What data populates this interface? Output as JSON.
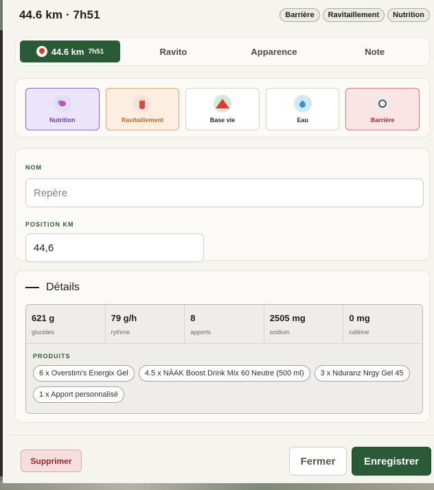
{
  "header": {
    "title": "44.6 km · 7h51",
    "chips": [
      "Barrière",
      "Ravitaillement",
      "Nutrition"
    ]
  },
  "tabs": {
    "active_main": "44.6 km",
    "active_sub": "7h51",
    "items": [
      "Ravito",
      "Apparence",
      "Note"
    ]
  },
  "types": [
    {
      "label": "Nutrition",
      "icon": "nutrition-icon",
      "selected": true
    },
    {
      "label": "Ravitaillement",
      "icon": "drink-cup-icon",
      "selected": true
    },
    {
      "label": "Base vie",
      "icon": "tent-icon",
      "selected": false
    },
    {
      "label": "Eau",
      "icon": "water-drop-icon",
      "selected": false
    },
    {
      "label": "Barrière",
      "icon": "stopwatch-icon",
      "selected": true
    }
  ],
  "form": {
    "name_label": "NOM",
    "name_placeholder": "Repère",
    "name_value": "",
    "position_label": "POSITION KM",
    "position_value": "44,6"
  },
  "details": {
    "title": "Détails",
    "stats": [
      {
        "value": "621 g",
        "label": "glucides"
      },
      {
        "value": "79 g/h",
        "label": "rythme"
      },
      {
        "value": "8",
        "label": "apports"
      },
      {
        "value": "2505 mg",
        "label": "sodium"
      },
      {
        "value": "0 mg",
        "label": "caféine"
      }
    ],
    "products_label": "PRODUITS",
    "products": [
      "6 x Overstim's Energix Gel",
      "4.5 x NÄAK Boost Drink Mix 60 Neutre (500 ml)",
      "3 x Nduranz Nrgy Gel 45",
      "1 x Apport personnalisé"
    ]
  },
  "footer": {
    "delete_label": "Supprimer",
    "close_label": "Fermer",
    "save_label": "Enregistrer"
  },
  "colors": {
    "primary": "#2b5a36",
    "nutrition": "#6a3fc1",
    "ravito": "#c76a2c",
    "barriere": "#a82f35"
  }
}
